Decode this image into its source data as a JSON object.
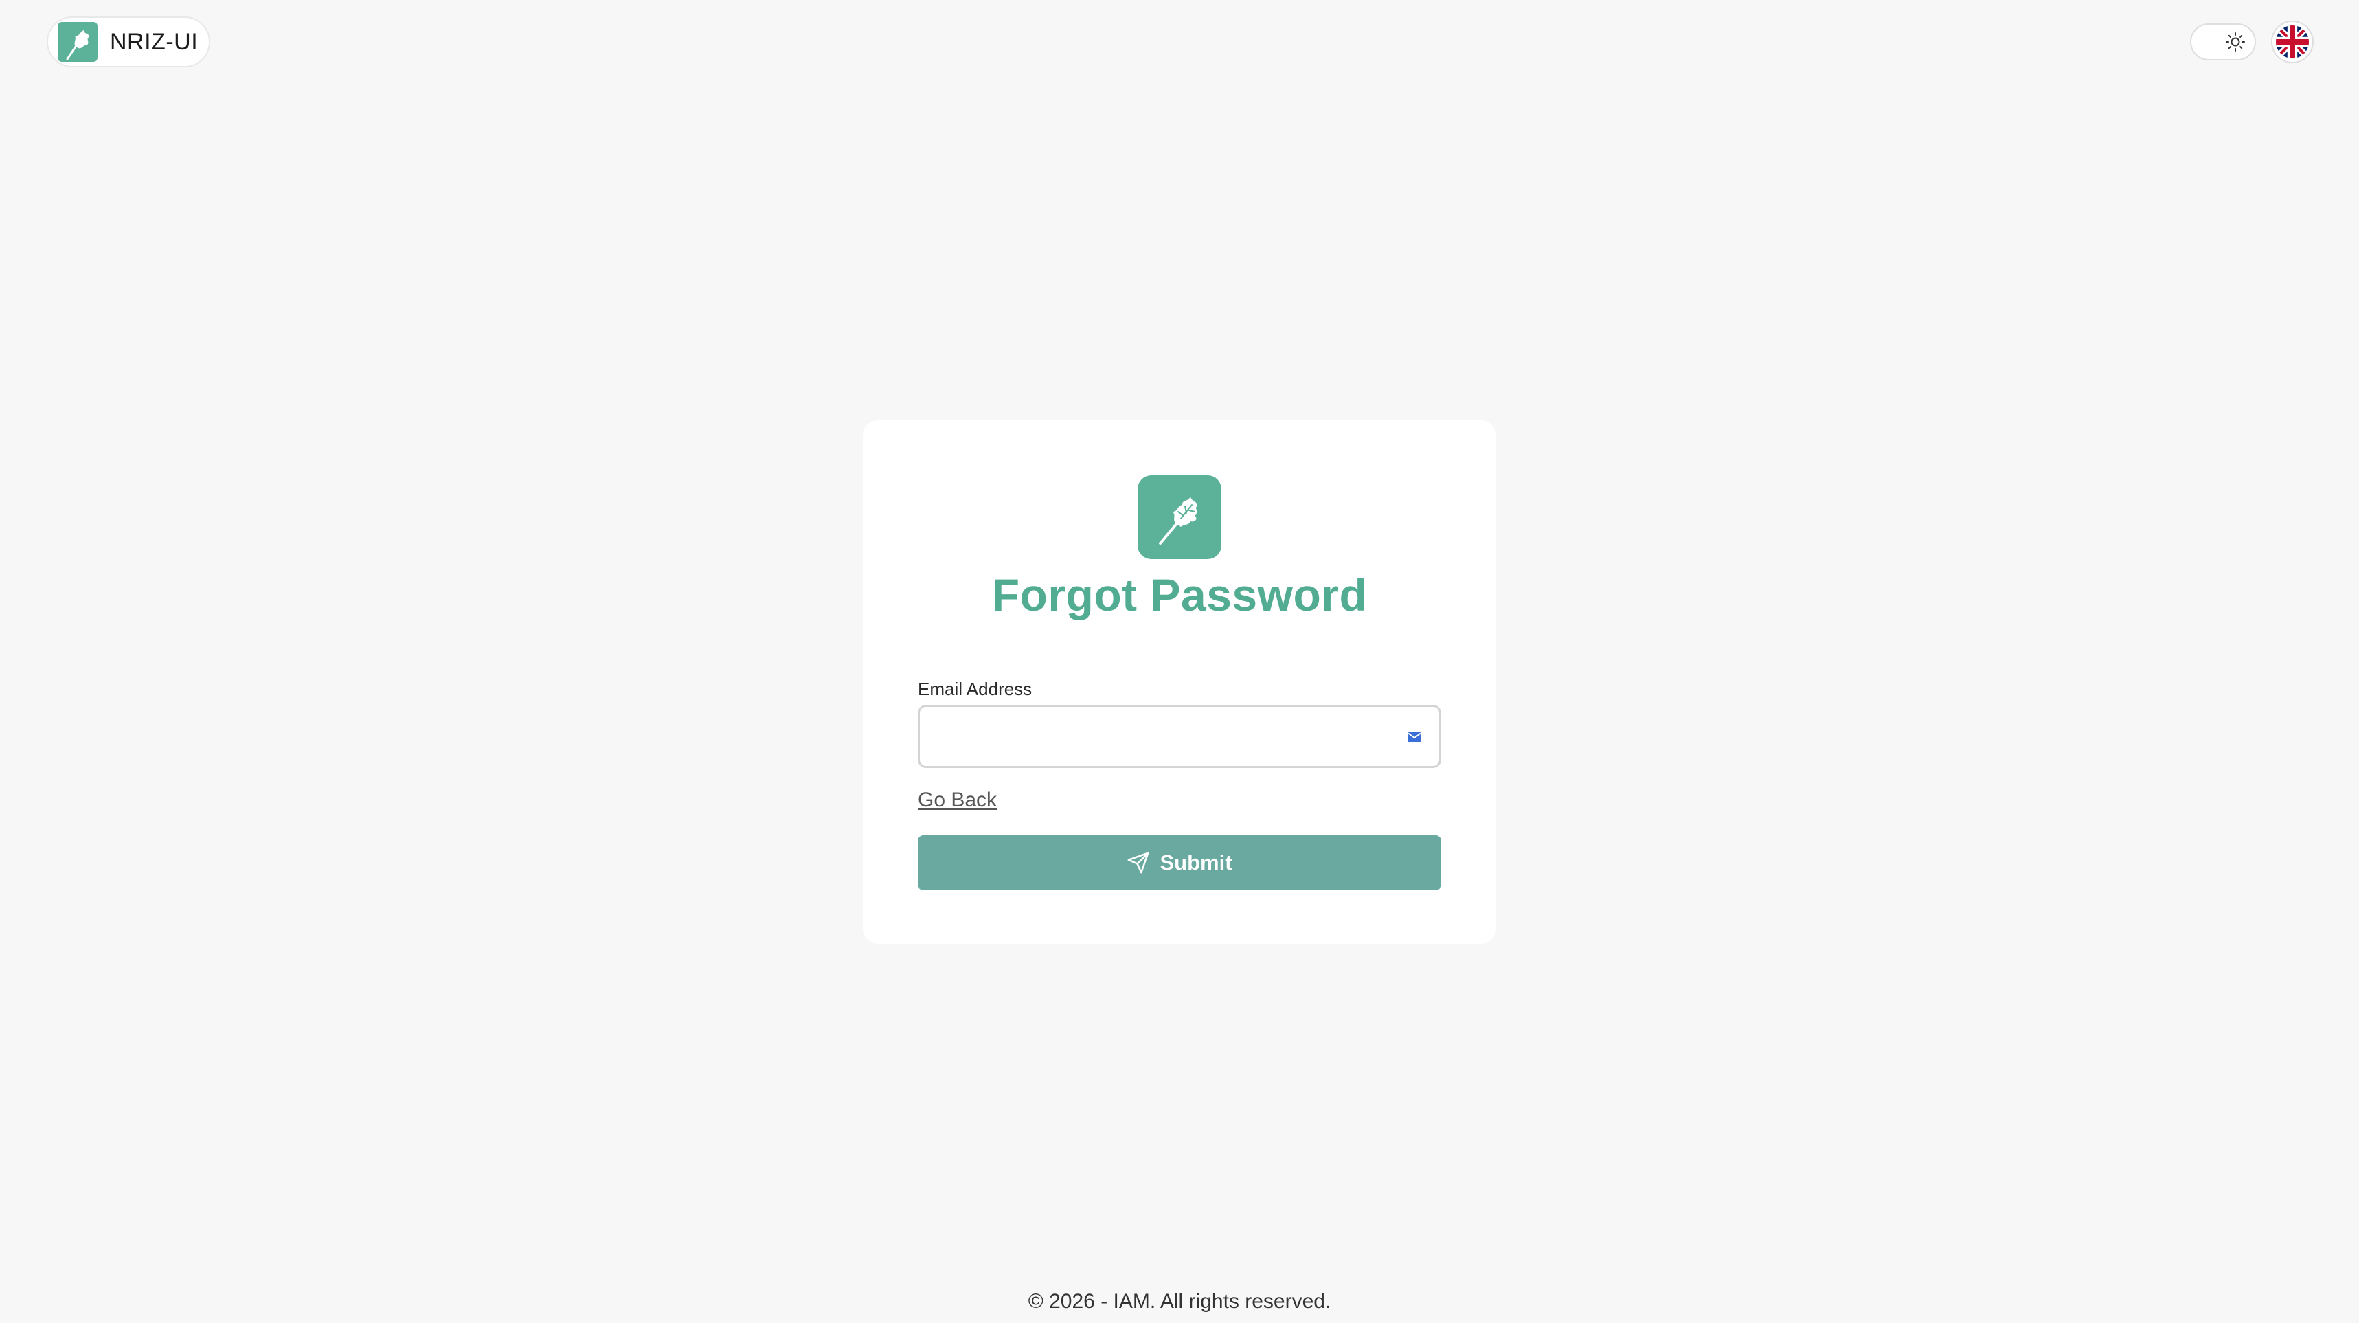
{
  "brand": {
    "name": "NRIZ-UI",
    "logo_icon": "oak-leaf-icon"
  },
  "header": {
    "theme_toggle_icon": "sun-icon",
    "language_flag_icon": "uk-flag-icon"
  },
  "card": {
    "logo_icon": "oak-leaf-icon",
    "title": "Forgot Password",
    "email": {
      "label": "Email Address",
      "value": "",
      "placeholder": "",
      "icon": "envelope-icon"
    },
    "go_back_label": "Go Back",
    "submit_label": "Submit",
    "submit_icon": "paper-plane-icon"
  },
  "footer": {
    "copyright": "© 2026 - IAM. All rights reserved."
  },
  "colors": {
    "brand_green": "#5bb299",
    "title_green": "#52ac92",
    "submit_button": "#6aa9a0",
    "page_background": "#f7f7f7",
    "mail_icon_blue": "#3b6fd8"
  }
}
